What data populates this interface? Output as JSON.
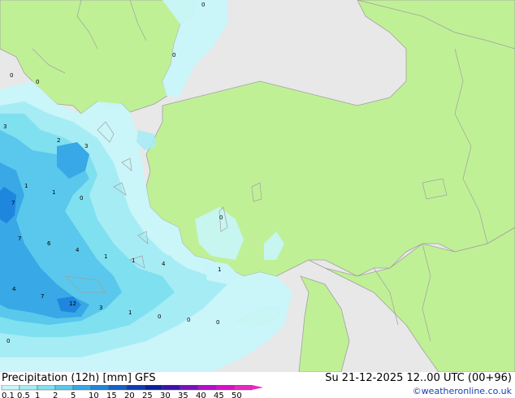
{
  "footer": {
    "title": "Precipitation (12h) [mm] GFS",
    "datetime": "Su 21-12-2025 12..00 UTC (00+96)",
    "credit": "©weatheronline.co.uk"
  },
  "legend": {
    "levels": [
      "0.1",
      "0.5",
      "1",
      "2",
      "5",
      "10",
      "15",
      "20",
      "25",
      "30",
      "35",
      "40",
      "45",
      "50"
    ],
    "colors": [
      "#c8f5fa",
      "#a6ecf5",
      "#7fe0f0",
      "#5ac8ec",
      "#38a8e6",
      "#1e86dc",
      "#1660c8",
      "#0c3cb4",
      "#0a1ea0",
      "#3c10b0",
      "#7a10c0",
      "#b010c8",
      "#d810c8",
      "#e828c0"
    ]
  },
  "map": {
    "land_color": "#c0f096",
    "sea_color": "#e8e8e8",
    "border_color": "#a0a0a0",
    "value_labels": [
      "0",
      "0",
      "0",
      "0",
      "3",
      "2",
      "3",
      "1",
      "1",
      "0",
      "7",
      "7",
      "6",
      "4",
      "1",
      "1",
      "4",
      "1",
      "0",
      "4",
      "7",
      "12",
      "3",
      "1",
      "0",
      "0",
      "0",
      "0"
    ]
  }
}
